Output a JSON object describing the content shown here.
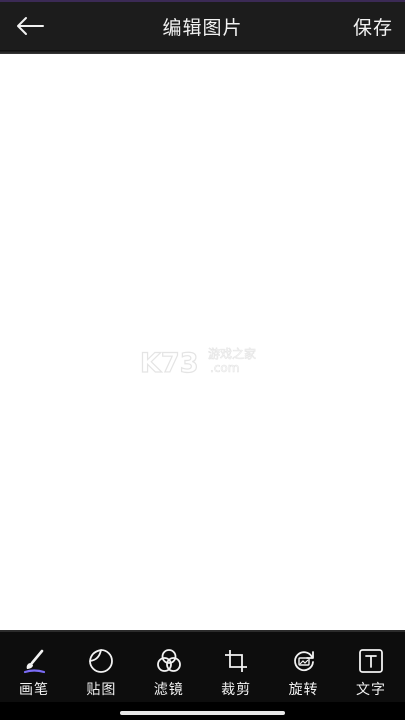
{
  "header": {
    "title": "编辑图片",
    "save_label": "保存",
    "back_icon": "arrow-left-icon"
  },
  "canvas": {
    "watermark": {
      "logo_text": "K73",
      "chinese": "游戏之家",
      "domain": ".com"
    }
  },
  "toolbar": {
    "items": [
      {
        "label": "画笔",
        "icon": "brush-icon"
      },
      {
        "label": "贴图",
        "icon": "sticker-icon"
      },
      {
        "label": "滤镜",
        "icon": "filter-icon"
      },
      {
        "label": "裁剪",
        "icon": "crop-icon"
      },
      {
        "label": "旋转",
        "icon": "rotate-icon"
      },
      {
        "label": "文字",
        "icon": "text-icon"
      }
    ]
  },
  "colors": {
    "header_bg": "#1c1c1c",
    "toolbar_bg": "#0d0d0d",
    "canvas_bg": "#ffffff",
    "text": "#f2f2f2",
    "brush_accent": "#7b6cf6"
  }
}
